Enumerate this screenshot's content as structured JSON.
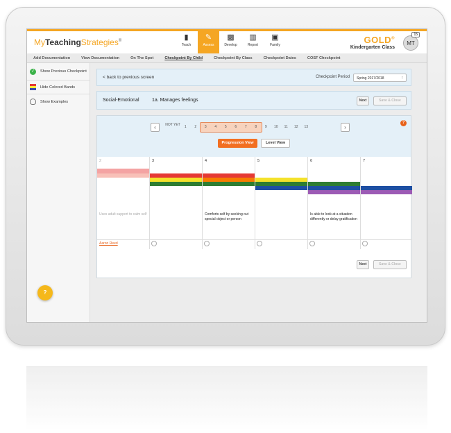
{
  "app": {
    "logo_prefix": "My",
    "logo_bold": "Teaching",
    "logo_suffix": "Strategies",
    "logo_mark": "®"
  },
  "nav": [
    {
      "label": "Teach",
      "icon": "book-icon"
    },
    {
      "label": "Assess",
      "icon": "pencil-icon",
      "active": true
    },
    {
      "label": "Develop",
      "icon": "blocks-icon"
    },
    {
      "label": "Report",
      "icon": "bar-chart-icon"
    },
    {
      "label": "Family",
      "icon": "family-icon"
    }
  ],
  "header": {
    "gold": "GOLD",
    "gold_mark": "®",
    "class_name": "Kindergarten Class",
    "avatar": "MT",
    "badge": "15"
  },
  "subnav": [
    "Add Documentation",
    "View Documentation",
    "On The Spot",
    "Checkpoint By Child",
    "Checkpoint By Class",
    "Checkpoint Dates",
    "COSF Checkpoint"
  ],
  "sidebar": {
    "show_previous": "Show Previous Checkpoint",
    "hide_bands": "Hide Colored Bands",
    "show_examples": "Show Examples",
    "help": "?"
  },
  "main": {
    "back": "< back to previous screen",
    "checkpoint_label": "Checkpoint Period",
    "checkpoint_value": "Spring 2017/2018",
    "domain": "Social-Emotional",
    "objective": "1a. Manages feelings",
    "next": "Next",
    "save_close": "Save & Close",
    "scale": {
      "not_yet": "NOT YET",
      "numbers": [
        "1",
        "2",
        "3",
        "4",
        "5",
        "6",
        "7",
        "8",
        "9",
        "10",
        "11",
        "12",
        "13"
      ],
      "selected_range": [
        "3",
        "7"
      ],
      "help": "?"
    },
    "progression_view": "Progression View",
    "level_view": "Level View",
    "columns": [
      {
        "label": "2",
        "desc": "Uses adult support to calm self"
      },
      {
        "label": "3",
        "desc": ""
      },
      {
        "label": "4",
        "desc": "Comforts self by seeking out special object or person"
      },
      {
        "label": "5",
        "desc": ""
      },
      {
        "label": "6",
        "desc": "Is able to look at a situation differently or delay gratification"
      },
      {
        "label": "7",
        "desc": ""
      }
    ],
    "child_name": "Aaron Reed"
  },
  "colors": {
    "accent": "#f5a623",
    "orange": "#f26f21",
    "red": "#e53935",
    "orange_band": "#f57c00",
    "yellow": "#f4e22b",
    "green": "#2e7d32",
    "blue": "#1e4fa3",
    "purple": "#9c5bb5",
    "pink": "#f4a3a3"
  }
}
